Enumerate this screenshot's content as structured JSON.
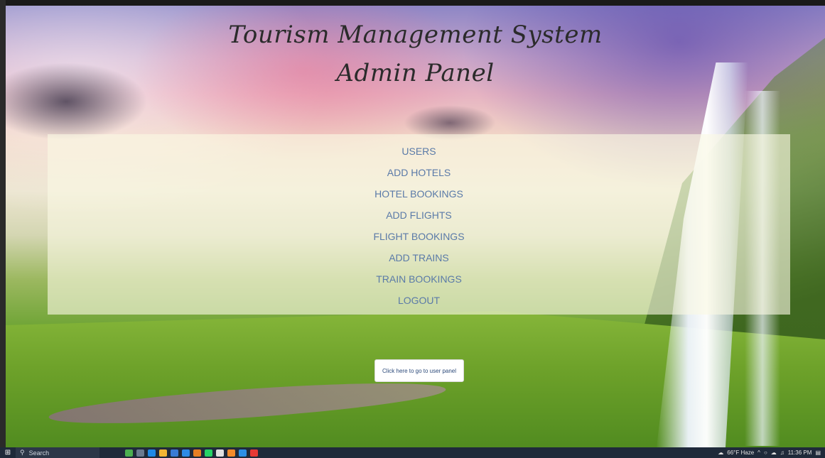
{
  "header": {
    "title_line1": "Tourism Management System",
    "title_line2": "Admin Panel"
  },
  "menu": {
    "items": [
      {
        "label": "USERS"
      },
      {
        "label": "ADD HOTELS"
      },
      {
        "label": "HOTEL BOOKINGS"
      },
      {
        "label": "ADD FLIGHTS"
      },
      {
        "label": "FLIGHT BOOKINGS"
      },
      {
        "label": "ADD TRAINS"
      },
      {
        "label": "TRAIN BOOKINGS"
      },
      {
        "label": "LOGOUT"
      }
    ]
  },
  "user_panel_button": {
    "label": "Click here to go to user panel"
  },
  "taskbar": {
    "search_placeholder": "Search",
    "weather": "66°F Haze",
    "time": "11:36 PM",
    "apps": [
      {
        "icon": "sticky-weather-icon",
        "color": "#4caf50"
      },
      {
        "icon": "task-view-icon",
        "color": "#6a7a90"
      },
      {
        "icon": "edge-browser-icon",
        "color": "#1e88e5"
      },
      {
        "icon": "file-explorer-icon",
        "color": "#f2b533"
      },
      {
        "icon": "store-icon",
        "color": "#3a7bd5"
      },
      {
        "icon": "mail-icon",
        "color": "#2b8ae6"
      },
      {
        "icon": "calendar-icon",
        "color": "#e67e22"
      },
      {
        "icon": "whatsapp-icon",
        "color": "#25d366"
      },
      {
        "icon": "paint-icon",
        "color": "#e0e0e0"
      },
      {
        "icon": "sublime-icon",
        "color": "#f18a2b"
      },
      {
        "icon": "vscode-icon",
        "color": "#2b8fe6"
      },
      {
        "icon": "chrome-icon",
        "color": "#e53935"
      }
    ]
  },
  "colors": {
    "menu_link": "#5a7aa8",
    "title": "#2b2b2b",
    "taskbar_bg": "#1f2a3a"
  }
}
